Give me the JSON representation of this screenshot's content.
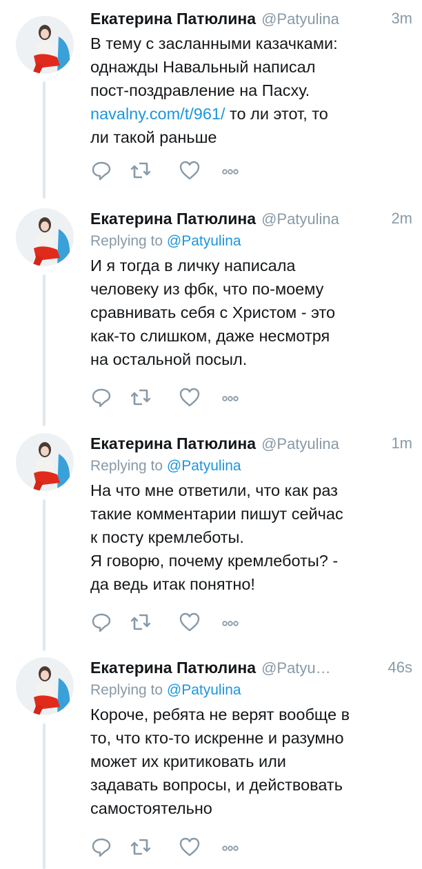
{
  "tweets": [
    {
      "name": "Екатерина Патюлина",
      "handle": "@Patyulina",
      "time": "3m",
      "reply_label": "",
      "reply_mention": "",
      "text_lines": [
        "В тему с засланными казачками:",
        "однажды Навальный написал",
        "пост-поздравление на Пасху."
      ],
      "link": "navalny.com/t/961/",
      "link_tail": " то ли этот, то",
      "text_lines_after": [
        "ли такой раньше"
      ]
    },
    {
      "name": "Екатерина Патюлина",
      "handle": "@Patyulina",
      "time": "2m",
      "reply_label": "Replying to",
      "reply_mention": "@Patyulina",
      "text_lines": [
        "И я тогда в личку написала",
        "человеку из фбк, что по-моему",
        "сравнивать себя с Христом - это",
        "как-то слишком, даже несмотря",
        "на остальной посыл."
      ]
    },
    {
      "name": "Екатерина Патюлина",
      "handle": "@Patyulina",
      "time": "1m",
      "reply_label": "Replying to",
      "reply_mention": "@Patyulina",
      "text_lines": [
        "На что мне ответили, что как раз",
        "такие комментарии пишут сейчас",
        "к посту кремлеботы.",
        "Я говорю, почему кремлеботы? -",
        "да ведь итак понятно!"
      ]
    },
    {
      "name": "Екатерина Патюлина",
      "handle": "@Patyu…",
      "time": "46s",
      "reply_label": "Replying to",
      "reply_mention": "@Patyulina",
      "text_lines": [
        "Короче, ребята не верят вообще в",
        "то, что кто-то искренне и разумно",
        "может их критиковать или",
        "задавать вопросы, и действовать",
        "самостоятельно"
      ]
    }
  ],
  "icons": [
    "reply-icon",
    "retweet-icon",
    "like-icon",
    "more-icon"
  ],
  "colors": {
    "link": "#1b95e0",
    "secondary": "#8899a6",
    "thread_line": "#e1e8ed",
    "text": "#14171a"
  }
}
